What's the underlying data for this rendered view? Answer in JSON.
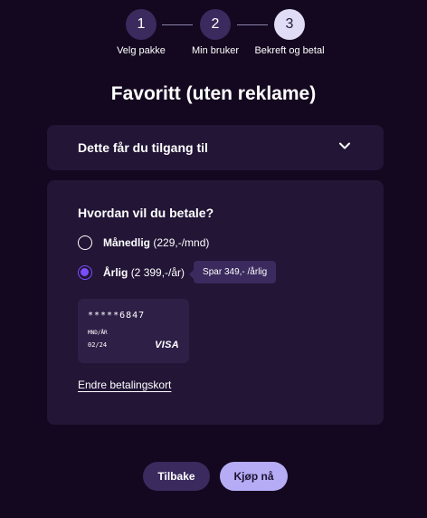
{
  "stepper": {
    "steps": [
      {
        "number": "1",
        "label": "Velg pakke",
        "state": "done"
      },
      {
        "number": "2",
        "label": "Min bruker",
        "state": "done"
      },
      {
        "number": "3",
        "label": "Bekreft og betal",
        "state": "active"
      }
    ]
  },
  "page_title": "Favoritt (uten reklame)",
  "accordion": {
    "label": "Dette får du tilgang til",
    "icon": "chevron-down-icon"
  },
  "payment": {
    "heading": "Hvordan vil du betale?",
    "options": [
      {
        "name": "Månedlig",
        "price": "(229,-/mnd)",
        "selected": false
      },
      {
        "name": "Årlig",
        "price": "(2 399,-/år)",
        "selected": true,
        "badge": "Spar 349,- /årlig"
      }
    ],
    "card": {
      "number": "*****6847",
      "expiry_label": "MND/ÅR",
      "expiry": "02/24",
      "brand": "VISA"
    },
    "change_card_label": "Endre betalingskort"
  },
  "buttons": {
    "back": "Tilbake",
    "buy": "Kjøp nå"
  },
  "colors": {
    "background": "#140820",
    "panel": "#221536",
    "accent": "#7b4dff",
    "primary_button": "#b6acf5"
  }
}
